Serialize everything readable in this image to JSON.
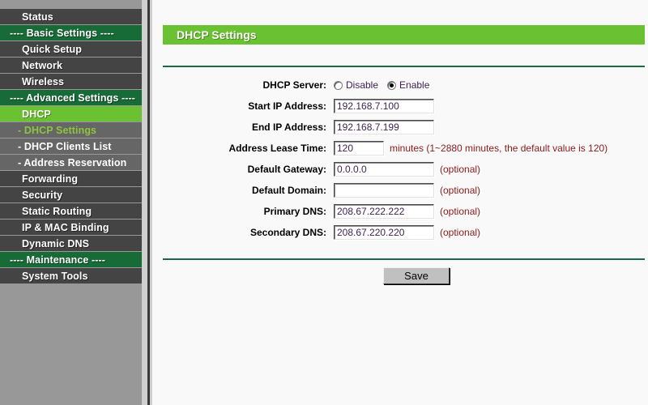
{
  "sidebar": {
    "items": [
      {
        "label": "Status",
        "type": "plain"
      },
      {
        "label": "---- Basic Settings ----",
        "type": "section"
      },
      {
        "label": "Quick Setup",
        "type": "plain"
      },
      {
        "label": "Network",
        "type": "plain"
      },
      {
        "label": "Wireless",
        "type": "plain"
      },
      {
        "label": "---- Advanced Settings ----",
        "type": "section"
      },
      {
        "label": "DHCP",
        "type": "active"
      },
      {
        "label": "- DHCP Settings",
        "type": "sub-current"
      },
      {
        "label": "- DHCP Clients List",
        "type": "sub"
      },
      {
        "label": "- Address Reservation",
        "type": "sub"
      },
      {
        "label": "Forwarding",
        "type": "plain"
      },
      {
        "label": "Security",
        "type": "plain"
      },
      {
        "label": "Static Routing",
        "type": "plain"
      },
      {
        "label": "IP & MAC Binding",
        "type": "plain"
      },
      {
        "label": "Dynamic DNS",
        "type": "plain"
      },
      {
        "label": "---- Maintenance ----",
        "type": "section"
      },
      {
        "label": "System Tools",
        "type": "plain"
      }
    ]
  },
  "main": {
    "title": "DHCP Settings",
    "dhcp_server": {
      "label": "DHCP Server:",
      "options": [
        {
          "label": "Disable",
          "selected": false
        },
        {
          "label": "Enable",
          "selected": true
        }
      ]
    },
    "fields": {
      "start_ip": {
        "label": "Start IP Address:",
        "value": "192.168.7.100"
      },
      "end_ip": {
        "label": "End IP Address:",
        "value": "192.168.7.199"
      },
      "lease_time": {
        "label": "Address Lease Time:",
        "value": "120",
        "hint": "minutes (1~2880 minutes, the default value is 120)"
      },
      "default_gateway": {
        "label": "Default Gateway:",
        "value": "0.0.0.0",
        "hint": "(optional)"
      },
      "default_domain": {
        "label": "Default Domain:",
        "value": "",
        "hint": "(optional)"
      },
      "primary_dns": {
        "label": "Primary DNS:",
        "value": "208.67.222.222",
        "hint": "(optional)"
      },
      "secondary_dns": {
        "label": "Secondary DNS:",
        "value": "208.67.220.220",
        "hint": "(optional)"
      }
    },
    "save_label": "Save"
  },
  "colors": {
    "accent_green": "#6ac131",
    "section_green": "#176b36",
    "sidebar_dark": "#444444",
    "sidebar_sub": "#666666",
    "sub_current_text": "#8cc63e",
    "hint_red": "#8b1a1a",
    "value_purple": "#3d1f52"
  }
}
